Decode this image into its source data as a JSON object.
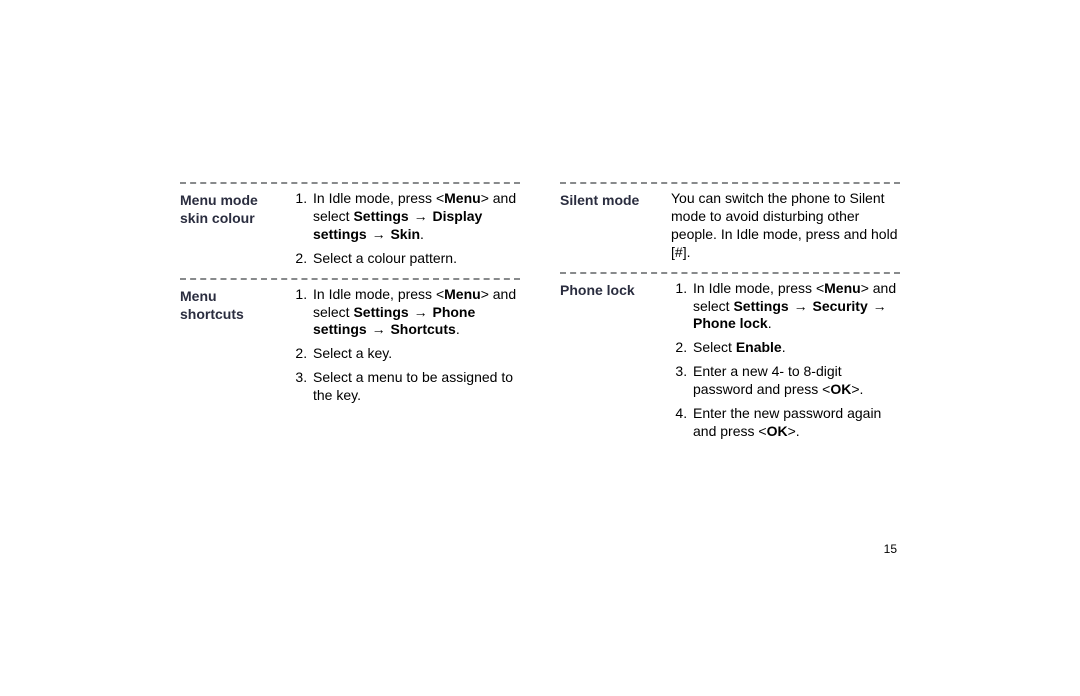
{
  "page_number": "15",
  "arrow": "→",
  "left": {
    "section1": {
      "label_l1": "Menu mode",
      "label_l2": "skin colour",
      "s1_pre": "In Idle mode, press <",
      "s1_menu": "Menu",
      "s1_mid": "> and select ",
      "s1_b1": "Settings",
      "s1_sp1": " ",
      "s1_b2": "Display settings",
      "s1_sp2": " ",
      "s1_b3": "Skin",
      "s1_end": ".",
      "s2": "Select a colour pattern."
    },
    "section2": {
      "label_l1": "Menu",
      "label_l2": "shortcuts",
      "s1_pre": "In Idle mode, press <",
      "s1_menu": "Menu",
      "s1_mid": "> and select ",
      "s1_b1": "Settings",
      "s1_sp1": " ",
      "s1_b2": "Phone settings",
      "s1_sp2": " ",
      "s1_b3": "Shortcuts",
      "s1_end": ".",
      "s2": "Select a key.",
      "s3": "Select a menu to be assigned to the key."
    }
  },
  "right": {
    "section1": {
      "label": "Silent mode",
      "p_a": "You can switch the phone to Silent mode to avoid disturbing other people. In Idle mode, press and hold [",
      "p_hash": "#",
      "p_b": "]."
    },
    "section2": {
      "label": "Phone lock",
      "s1_pre": "In Idle mode, press <",
      "s1_menu": "Menu",
      "s1_mid": "> and select ",
      "s1_b1": "Settings",
      "s1_sp1": " ",
      "s1_b2": "Security",
      "s1_sp2": " ",
      "s1_b3": "Phone lock",
      "s1_end": ".",
      "s2_a": "Select ",
      "s2_b": "Enable",
      "s2_c": ".",
      "s3_a": "Enter a new 4- to 8-digit password and press <",
      "s3_b": "OK",
      "s3_c": ">.",
      "s4_a": "Enter the new password again and press <",
      "s4_b": "OK",
      "s4_c": ">."
    }
  }
}
